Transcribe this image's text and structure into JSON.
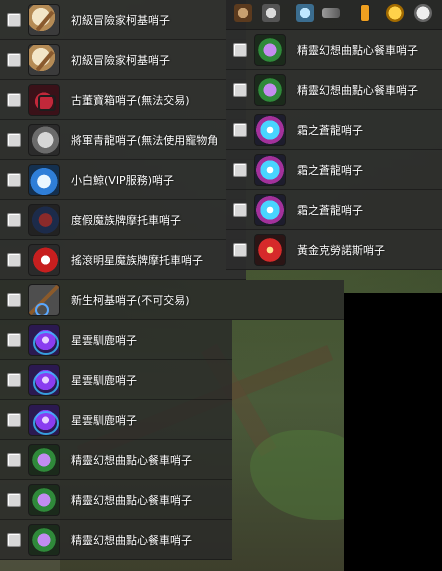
{
  "left_list": [
    {
      "label": "初級冒險家柯基哨子",
      "icon": "whistle-icon"
    },
    {
      "label": "初級冒險家柯基哨子",
      "icon": "whistle-icon"
    },
    {
      "label": "古董寶箱哨子(無法交易)",
      "icon": "chest-icon"
    },
    {
      "label": "將軍青龍哨子(無法使用寵物角",
      "icon": "dragon-icon"
    },
    {
      "label": "小白鯨(VIP服務)哨子",
      "icon": "whale-icon"
    },
    {
      "label": "度假魔族牌摩托車哨子",
      "icon": "mask-icon"
    },
    {
      "label": "搖滾明星魔族牌摩托車哨子",
      "icon": "rock-icon"
    },
    {
      "label": "新生柯基哨子(不可交易)",
      "icon": "pick-icon"
    },
    {
      "label": "星雲馴鹿哨子",
      "icon": "nebula-icon"
    },
    {
      "label": "星雲馴鹿哨子",
      "icon": "nebula-icon"
    },
    {
      "label": "星雲馴鹿哨子",
      "icon": "nebula-icon"
    },
    {
      "label": "精靈幻想曲點心餐車哨子",
      "icon": "cart-icon"
    },
    {
      "label": "精靈幻想曲點心餐車哨子",
      "icon": "cart-icon"
    },
    {
      "label": "精靈幻想曲點心餐車哨子",
      "icon": "cart-icon"
    }
  ],
  "right_list": [
    {
      "label": "精靈幻想曲點心餐車哨子",
      "icon": "cart-icon"
    },
    {
      "label": "精靈幻想曲點心餐車哨子",
      "icon": "cart-icon"
    },
    {
      "label": "霜之蒼龍哨子",
      "icon": "ice-dragon-icon"
    },
    {
      "label": "霜之蒼龍哨子",
      "icon": "ice-dragon-icon"
    },
    {
      "label": "霜之蒼龍哨子",
      "icon": "ice-dragon-icon"
    },
    {
      "label": "黃金克勞諾斯哨子",
      "icon": "gold-icon"
    }
  ],
  "toolbar_icons": [
    "bag-icon",
    "shield-icon",
    "gem-icon",
    "fish-icon",
    "scroll-icon",
    "coin-icon",
    "pearl-icon"
  ]
}
